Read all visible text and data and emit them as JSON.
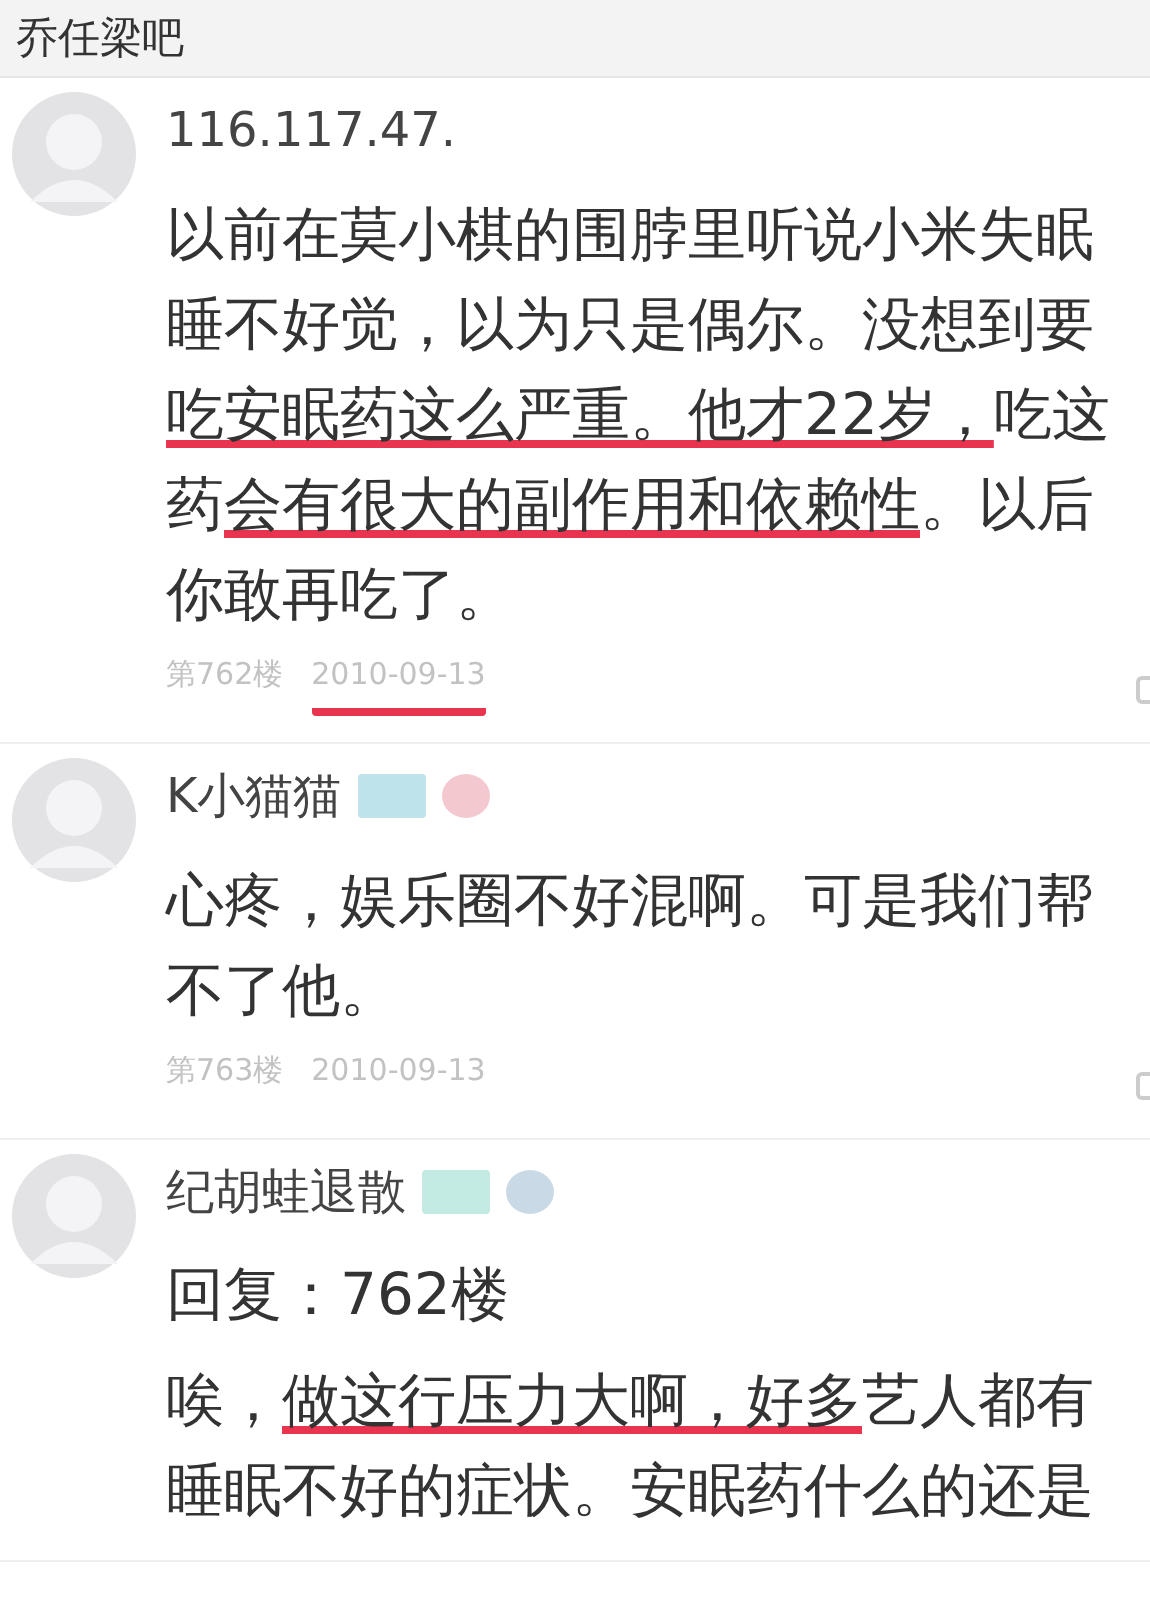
{
  "header": {
    "title": "乔任梁吧"
  },
  "posts": [
    {
      "author": "116.117.47.",
      "body": [
        {
          "text": "以前在莫小棋的围脖里听说小米失眠睡不好觉，以为只是偶尔。没想到要",
          "underlined": false
        },
        {
          "text": "吃安眠药这么严重。他才22岁，",
          "underlined": true
        },
        {
          "text": "吃这药",
          "underlined": false
        },
        {
          "text": "会有很大的副作用和依赖性",
          "underlined": true
        },
        {
          "text": "。以后你敢再吃了。",
          "underlined": false
        }
      ],
      "floor": "第762楼",
      "date": "2010-09-13",
      "date_underlined": true
    },
    {
      "author": "K小猫猫",
      "badges": [
        {
          "kind": "level",
          "color": "#bfe3ea"
        },
        {
          "kind": "round",
          "color": "#f3c9cf"
        }
      ],
      "body": [
        {
          "text": "心疼，娱乐圈不好混啊。可是我们帮不了他。",
          "underlined": false
        }
      ],
      "floor": "第763楼",
      "date": "2010-09-13",
      "date_underlined": false
    },
    {
      "author": "纪胡蛙退散",
      "badges": [
        {
          "kind": "level",
          "color": "#c4ebe3"
        },
        {
          "kind": "round",
          "color": "#c9d9e6"
        }
      ],
      "reply_to": "回复：762楼",
      "body": [
        {
          "text": "唉，",
          "underlined": false
        },
        {
          "text": "做这行压力大啊，好多",
          "underlined": true
        },
        {
          "text": "艺人都有睡眠不好的症状。安眠药什么的还是",
          "underlined": false
        }
      ]
    }
  ]
}
